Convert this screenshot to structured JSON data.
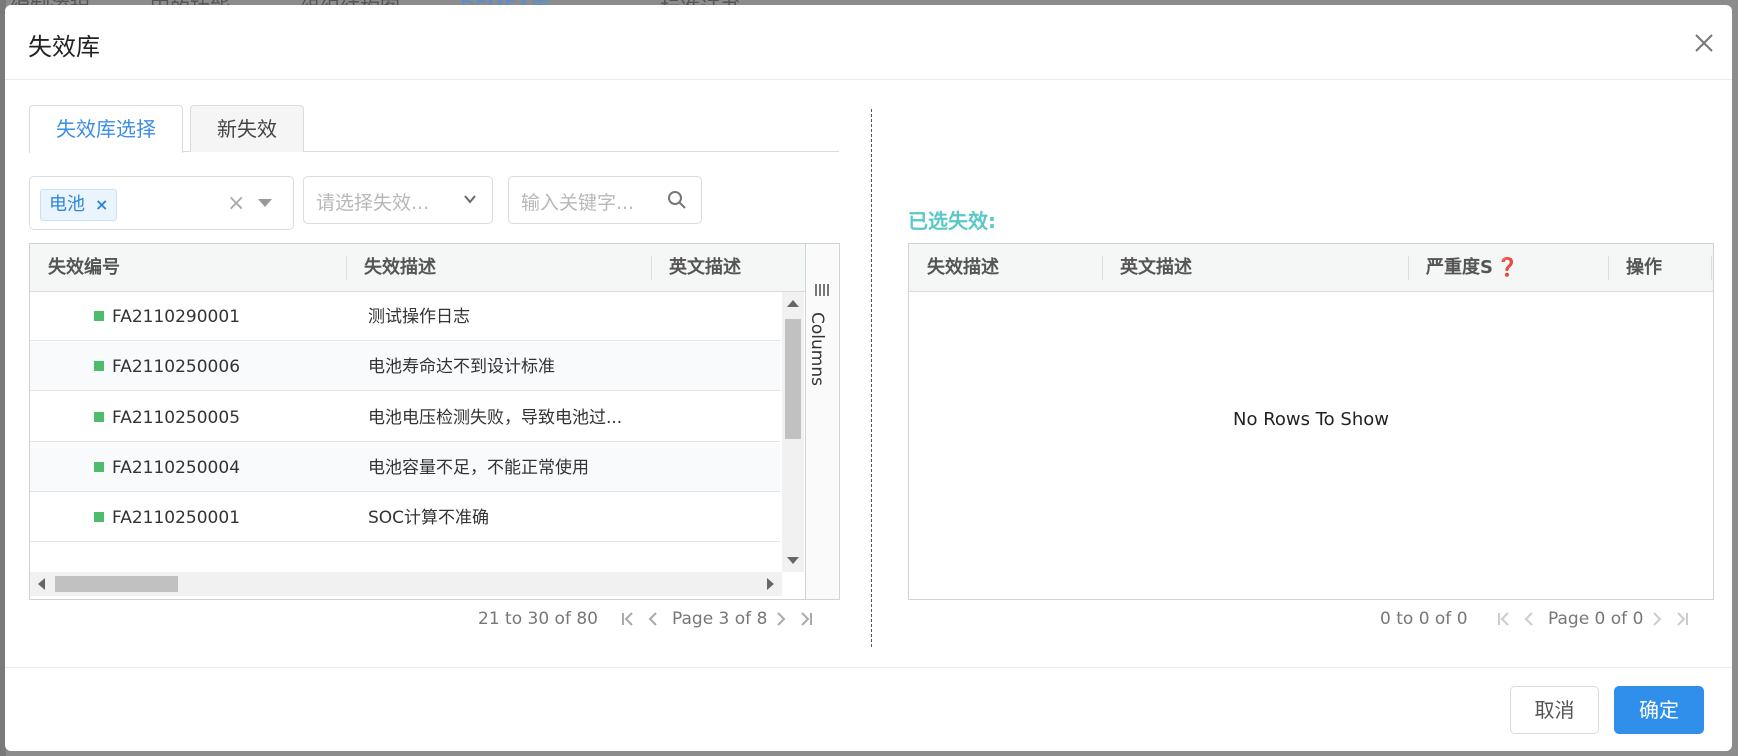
{
  "backdrop": {
    "fragments": [
      "编制流程",
      "田的功能",
      "组织结构图",
      "DFMEA库",
      "标准证书"
    ]
  },
  "modal": {
    "title": "失效库"
  },
  "tabs": [
    {
      "label": "失效库选择",
      "active": true
    },
    {
      "label": "新失效",
      "active": false
    }
  ],
  "filters": {
    "category_tag": "电池",
    "tag_remove": "×",
    "clear": "×",
    "type_placeholder": "请选择失效...",
    "keyword_placeholder": "输入关键字..."
  },
  "left_grid": {
    "headers": [
      "失效编号",
      "失效描述",
      "英文描述"
    ],
    "rows": [
      {
        "code": "FA2110290001",
        "desc": "测试操作日志",
        "en": ""
      },
      {
        "code": "FA2110250006",
        "desc": "电池寿命达不到设计标准",
        "en": ""
      },
      {
        "code": "FA2110250005",
        "desc": "电池电压检测失败，导致电池过...",
        "en": ""
      },
      {
        "code": "FA2110250004",
        "desc": "电池容量不足，不能正常使用",
        "en": ""
      },
      {
        "code": "FA2110250001",
        "desc": "SOC计算不准确",
        "en": ""
      }
    ],
    "columns_panel": "Columns",
    "status_color": "#4dbd6b"
  },
  "left_pager": {
    "summary": "21 to 30 of 80",
    "page": "Page 3 of 8"
  },
  "right_pane": {
    "title": "已选失效:",
    "headers": [
      "失效描述",
      "英文描述",
      "严重度S",
      "操作"
    ],
    "help_icon": "❓",
    "empty_text": "No Rows To Show"
  },
  "right_pager": {
    "summary": "0 to 0 of 0",
    "page": "Page 0 of 0"
  },
  "footer": {
    "cancel": "取消",
    "ok": "确定"
  },
  "colors": {
    "accent": "#2f8fea",
    "selected_title": "#5bc8c8",
    "tab_active": "#3a8ee6"
  }
}
